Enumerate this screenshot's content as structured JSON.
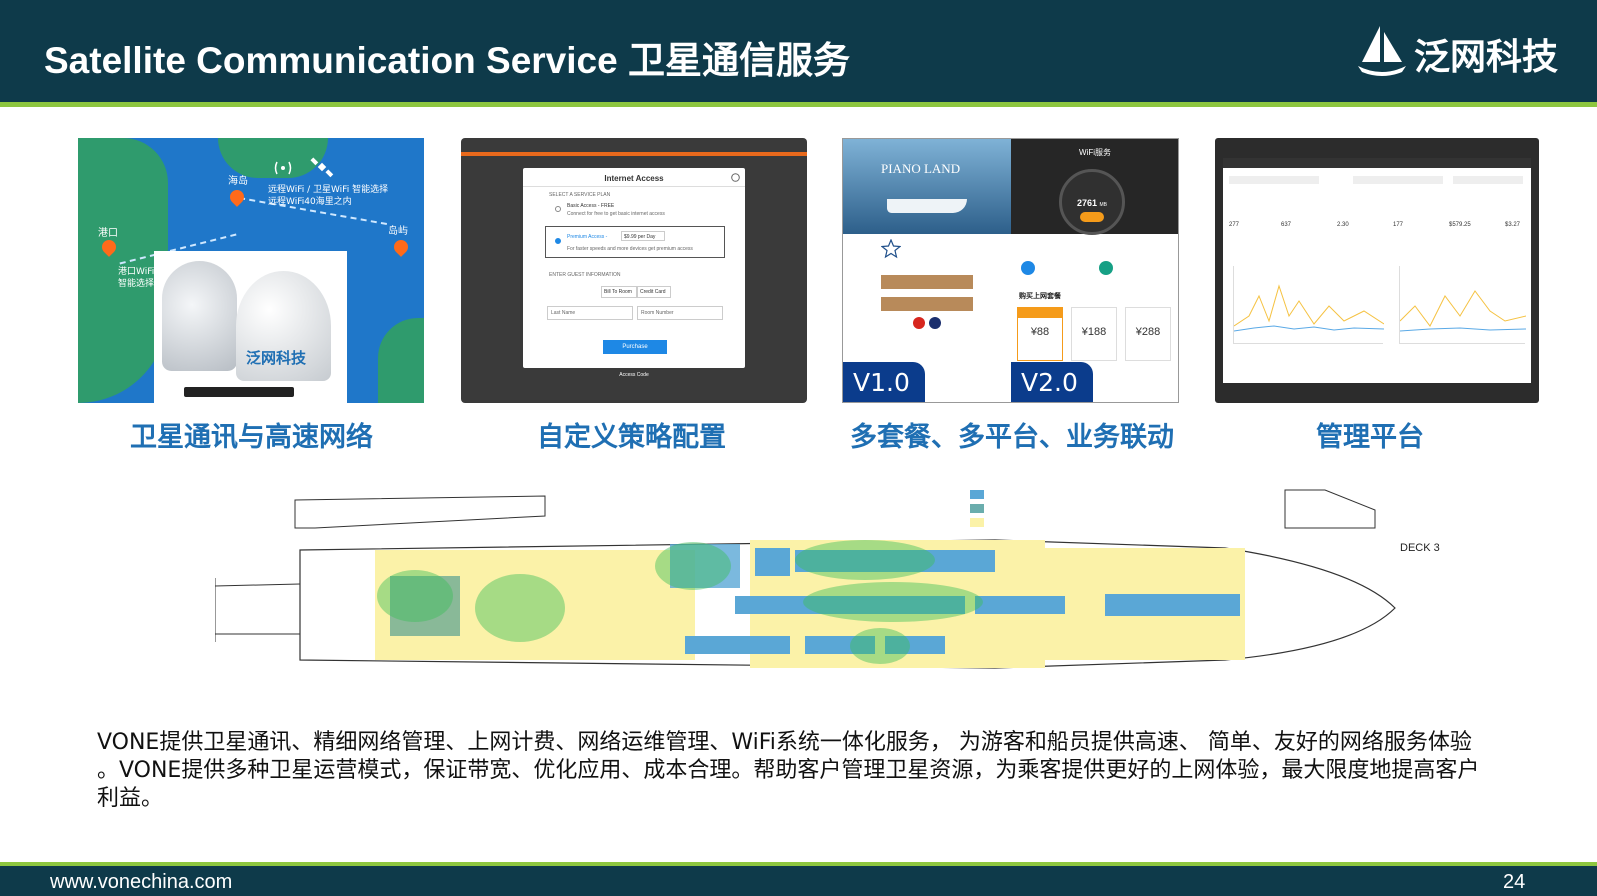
{
  "header": {
    "title": "Satellite Communication Service 卫星通信服务",
    "logo_text": "泛网科技"
  },
  "panels": [
    {
      "caption": "卫星通讯与高速网络",
      "labels": {
        "haidao": "海岛",
        "gangkou": "港口",
        "daoyu": "岛屿",
        "wifi_line1": "远程WiFi / 卫星WiFi 智能选择",
        "wifi_line2": "远程WiFi40海里之内",
        "port_line1": "港口WiFi",
        "port_line2": "智能选择"
      },
      "product_brand": "泛网科技"
    },
    {
      "caption": "自定义策略配置",
      "dialog": {
        "title": "Internet Access",
        "section1": "SELECT A SERVICE PLAN",
        "plan_basic": "Basic Access - FREE",
        "plan_basic_sub": "Connect for free to get basic internet access",
        "plan_premium": "Premium Access -",
        "plan_premium_price": "$9.99 per Day",
        "plan_premium_sub": "For faster speeds and more devices get premium access",
        "section2": "ENTER GUEST INFORMATION",
        "tab_room": "Bill To Room",
        "tab_card": "Credit Card",
        "field_last": "Last Name",
        "field_room": "Room Number",
        "button": "Purchase",
        "footer": "Access Code"
      }
    },
    {
      "caption": "多套餐、多平台、业务联动",
      "brand": "PIANO LAND",
      "service_title": "WiFi服务",
      "gauge_value": "2761",
      "gauge_unit": "MB",
      "section": "购买上网套餐",
      "prices": [
        "¥88",
        "¥188",
        "¥288"
      ],
      "version_left": "V1.0",
      "version_right": "V2.0"
    },
    {
      "caption": "管理平台",
      "stats": [
        "277",
        "637",
        "2.30",
        "177",
        "$579.25",
        "$3.27"
      ]
    }
  ],
  "deck": {
    "label": "DECK 3"
  },
  "description": "VONE提供卫星通讯、精细网络管理、上网计费、网络运维管理、WiFi系统一体化服务， 为游客和船员提供高速、 简单、友好的网络服务体验 。VONE提供多种卫星运营模式，保证带宽、优化应用、成本合理。帮助客户管理卫星资源，为乘客提供更好的上网体验，最大限度地提高客户利益。",
  "footer": {
    "url": "www.vonechina.com",
    "page": "24"
  }
}
